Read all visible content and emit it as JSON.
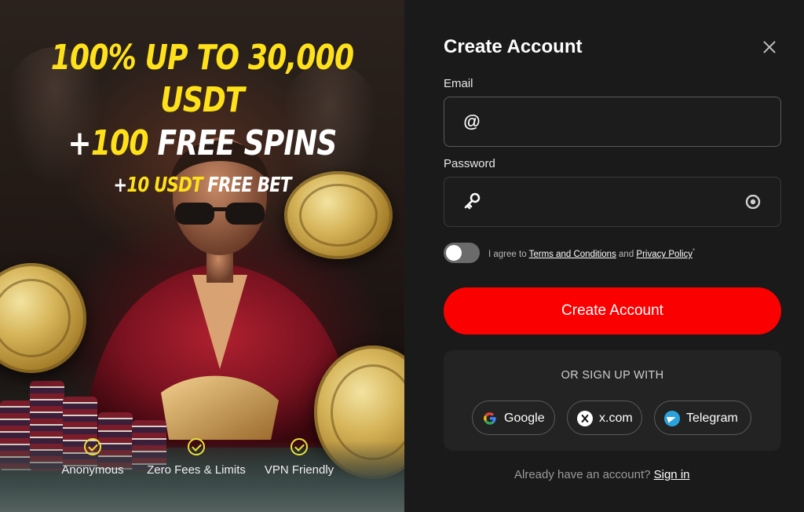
{
  "promo": {
    "headline_line1_a": "100%",
    "headline_line1_b": "UP TO",
    "headline_line1_c": "30,000",
    "headline_line2": "USDT",
    "headline_line3_a": "+",
    "headline_line3_b": "100",
    "headline_line3_c": "FREE SPINS",
    "headline_line4_a": "+",
    "headline_line4_b": "10 USDT",
    "headline_line4_c": "FREE BET",
    "features": [
      {
        "label": "Anonymous"
      },
      {
        "label": "Zero Fees & Limits"
      },
      {
        "label": "VPN Friendly"
      }
    ],
    "accent_color": "#ffe11a"
  },
  "form": {
    "title": "Create Account",
    "email": {
      "label": "Email",
      "value": "",
      "placeholder": ""
    },
    "password": {
      "label": "Password",
      "value": "",
      "placeholder": ""
    },
    "consent": {
      "prefix": "I agree to",
      "terms_link": "Terms and Conditions",
      "and": "and",
      "privacy_link": "Privacy Policy",
      "required_mark": "*",
      "checked": false
    },
    "submit_label": "Create Account",
    "submit_color": "#fb0000",
    "social": {
      "title": "OR SIGN UP WITH",
      "buttons": [
        {
          "label": "Google",
          "icon": "google-icon"
        },
        {
          "label": "x.com",
          "icon": "x-icon"
        },
        {
          "label": "Telegram",
          "icon": "telegram-icon"
        }
      ]
    },
    "signin_prompt": "Already have an account?",
    "signin_link": "Sign in"
  }
}
